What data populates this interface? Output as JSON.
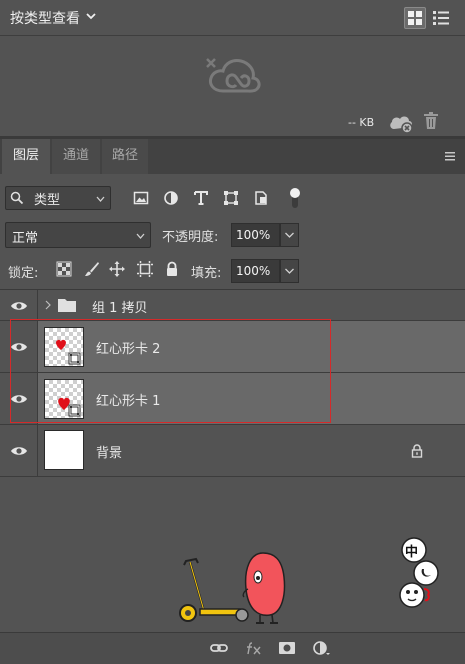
{
  "libraries": {
    "view_label": "按类型查看",
    "size_text": "-- KB"
  },
  "tabs": [
    {
      "label": "图层",
      "active": true
    },
    {
      "label": "通道",
      "active": false
    },
    {
      "label": "路径",
      "active": false
    }
  ],
  "filter": {
    "kind_label": "类型",
    "icons": [
      "image-filter-icon",
      "adjustment-filter-icon",
      "type-filter-icon",
      "shape-filter-icon",
      "smart-object-filter-icon",
      "filter-toggle-switch"
    ]
  },
  "blend": {
    "mode": "正常",
    "opacity_label": "不透明度:",
    "opacity_value": "100%"
  },
  "lock": {
    "label": "锁定:",
    "icons": [
      "lock-transparent-pixels-icon",
      "lock-image-pixels-icon",
      "lock-position-icon",
      "lock-artboard-icon",
      "lock-all-icon"
    ],
    "fill_label": "填充:",
    "fill_value": "100%"
  },
  "layers": [
    {
      "name": "组 1 拷贝",
      "type": "group",
      "visible": true,
      "collapsed": true
    },
    {
      "name": "红心形卡 2",
      "type": "pixel",
      "visible": true,
      "selected": true
    },
    {
      "name": "红心形卡 1",
      "type": "pixel",
      "visible": true,
      "selected": true
    },
    {
      "name": "背景",
      "type": "background",
      "visible": true,
      "locked": true
    }
  ],
  "emoji_sticker": {
    "top_char": "中"
  },
  "colors": {
    "panel_bg": "#535353",
    "tab_bar_bg": "#424242",
    "selected_row_bg": "#696969",
    "highlight_border": "#d42a2a",
    "heart_red": "#e0101a"
  },
  "bottom_bar_icons": [
    "link-layers-icon",
    "layer-style-fx-icon",
    "add-mask-icon",
    "adjustment-layer-icon"
  ]
}
